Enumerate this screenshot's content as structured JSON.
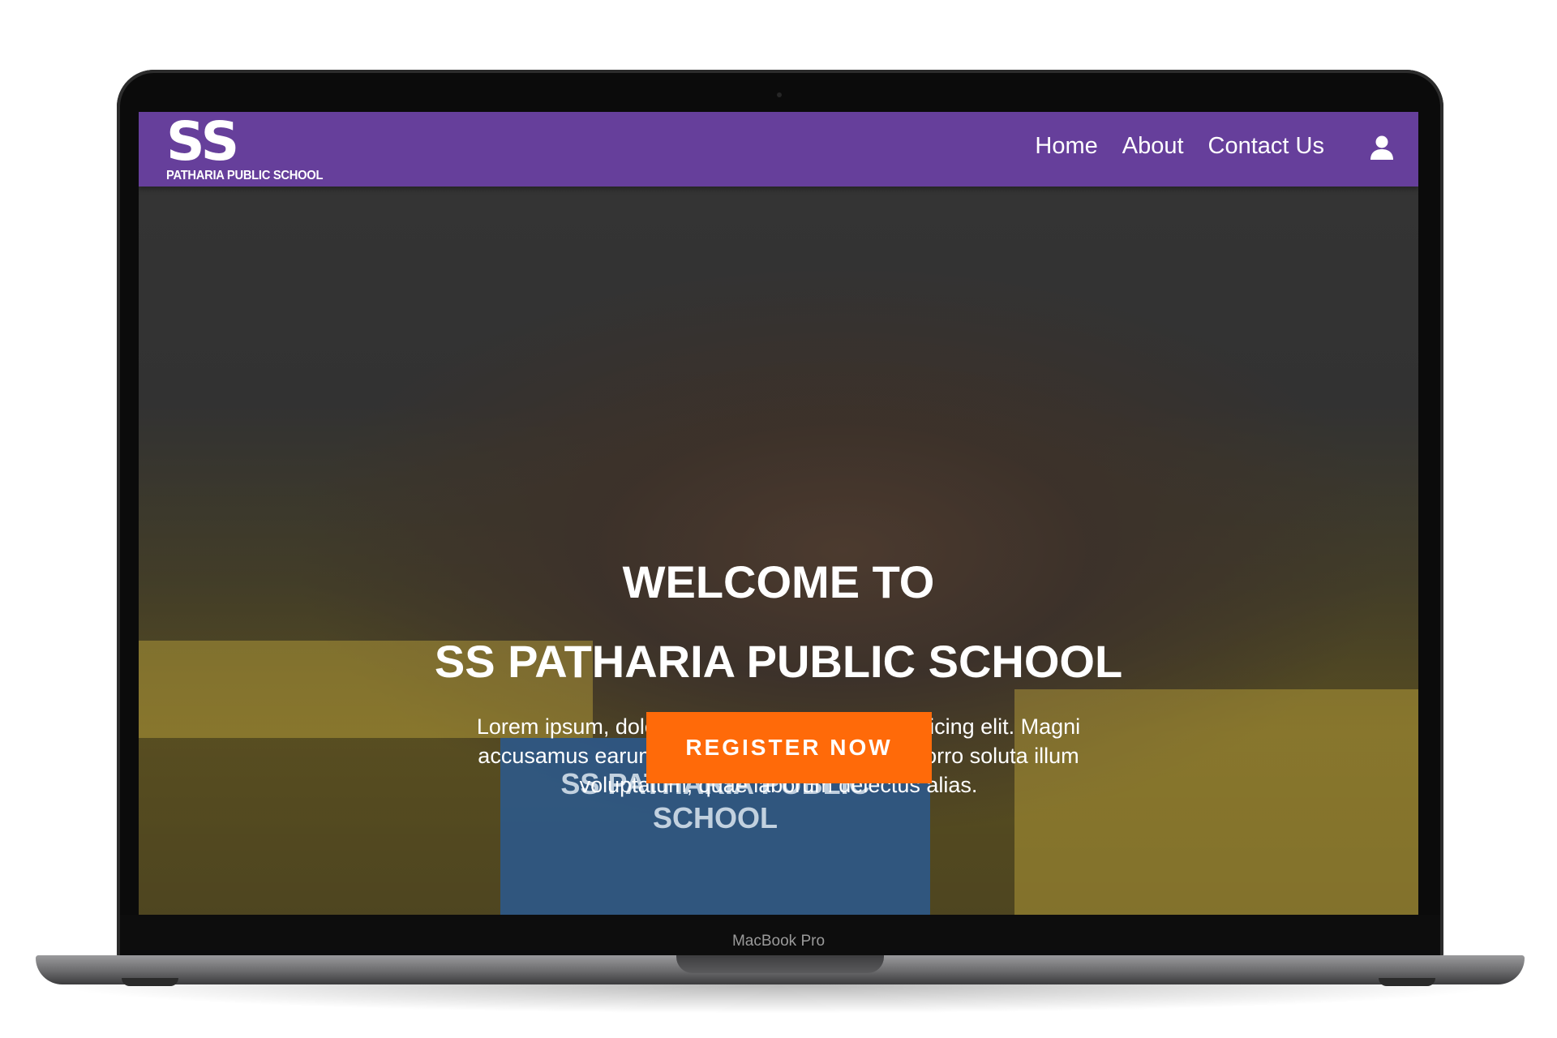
{
  "device": {
    "label": "MacBook Pro"
  },
  "navbar": {
    "logo_mark": "SS",
    "logo_text": "PATHARIA PUBLIC SCHOOL",
    "links": [
      {
        "label": "Home"
      },
      {
        "label": "About"
      },
      {
        "label": "Contact Us"
      }
    ],
    "user_icon": "user-icon"
  },
  "hero": {
    "title_line1": "WELCOME TO",
    "title_line2": "SS PATHARIA PUBLIC SCHOOL",
    "description": "Lorem ipsum, dolor sit amet consectetur adipisicing elit. Magni accusamus earum quod, molestiae expedita porro soluta illum voluptatum, quae laborum delectus alias.",
    "cta_label": "REGISTER NOW",
    "book_title": "SS PATHARIA PUBLIC SCHOOL"
  },
  "colors": {
    "navbar": "#663f9b",
    "cta": "#ff6a09"
  }
}
